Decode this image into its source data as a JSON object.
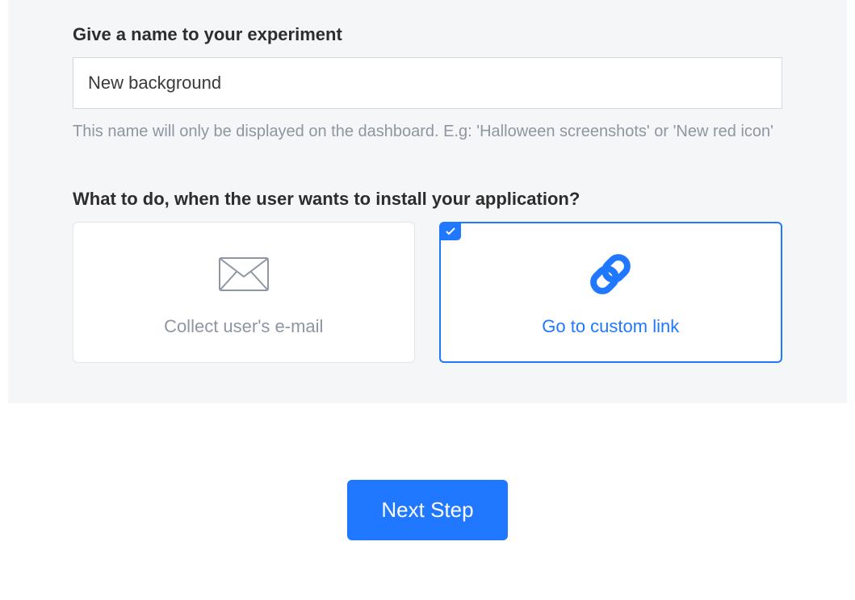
{
  "name_section": {
    "label": "Give a name to your experiment",
    "value": "New background",
    "help": "This name will only be displayed on the dashboard. E.g: 'Halloween screenshots' or 'New red icon'"
  },
  "install_section": {
    "label": "What to do, when the user wants to install your application?",
    "options": {
      "email": "Collect user's e-mail",
      "link": "Go to custom link"
    }
  },
  "colors": {
    "accent": "#1f78ff",
    "muted": "#8d96a2"
  },
  "footer": {
    "next": "Next Step"
  }
}
